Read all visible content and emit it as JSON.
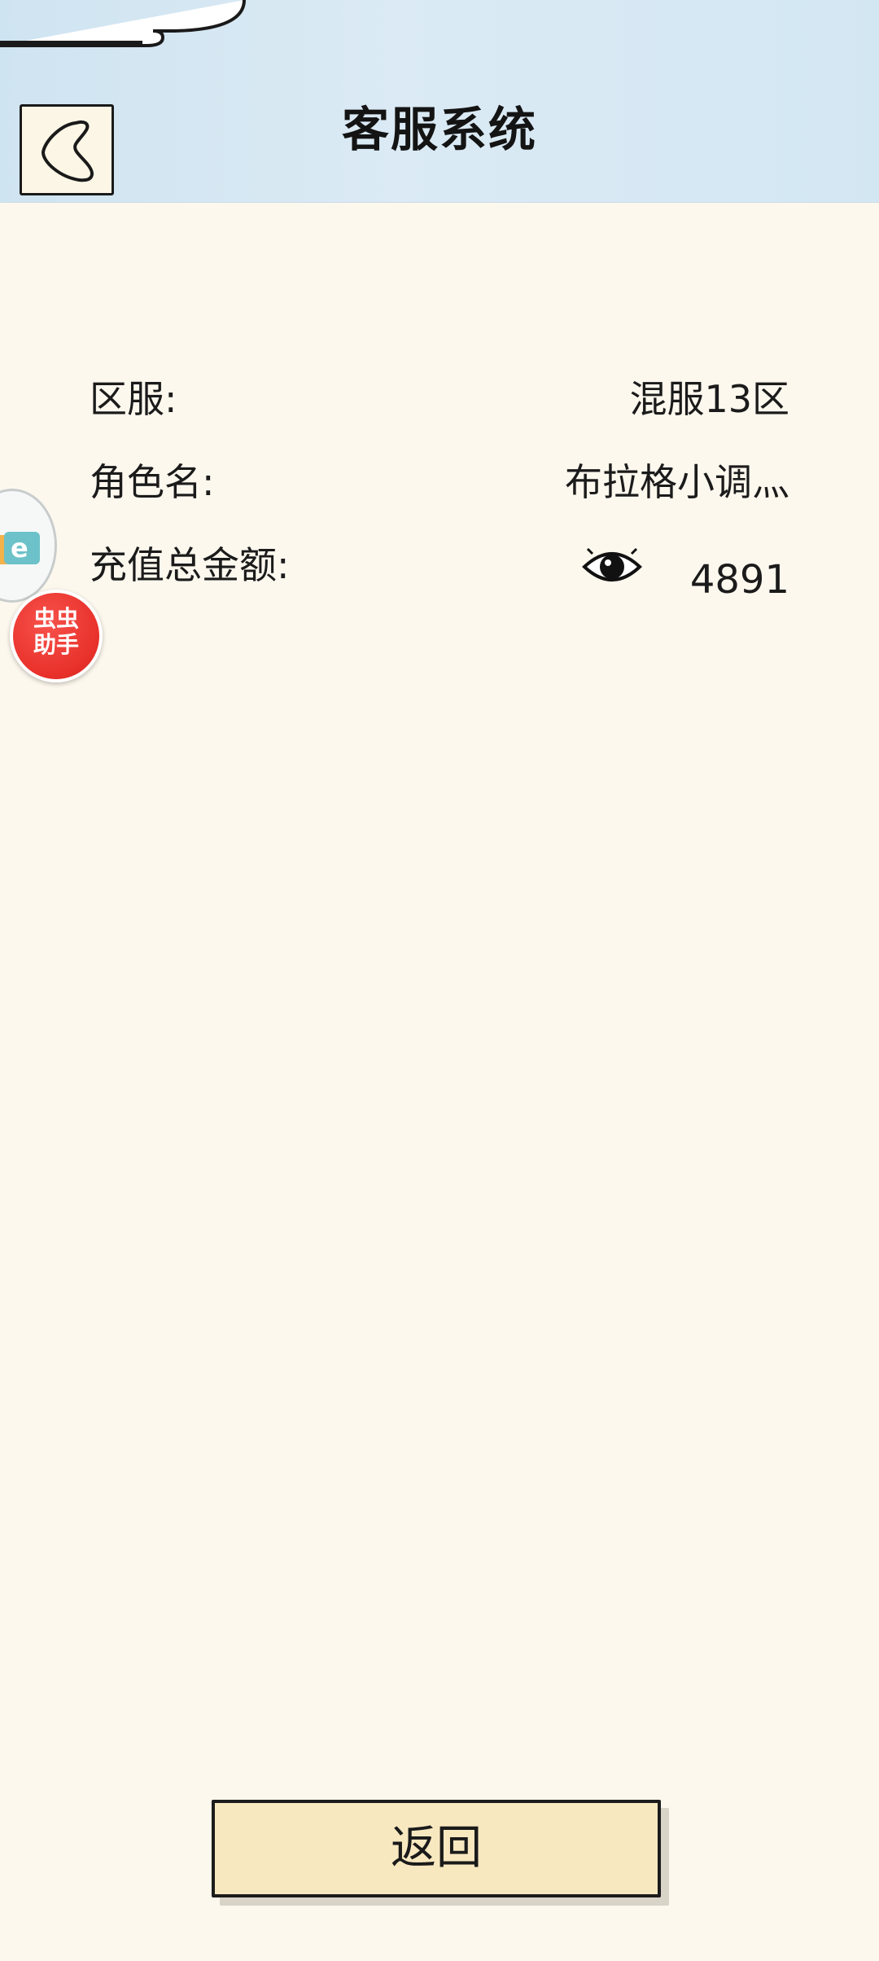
{
  "header": {
    "title": "客服系统",
    "back_icon": "chevron-left-icon"
  },
  "info": {
    "server_label": "区服:",
    "server_value": "混服13区",
    "role_label": "角色名:",
    "role_value": "布拉格小调灬",
    "recharge_label": "充值总金额:",
    "recharge_value": "4891",
    "visibility_icon": "eye-icon"
  },
  "floating": {
    "logo_icon": "app-logo-icon",
    "helper_label_line1": "虫虫",
    "helper_label_line2": "助手"
  },
  "footer": {
    "return_label": "返回"
  },
  "colors": {
    "header_bg": "#d6e8f4",
    "page_bg": "#fdf8ee",
    "button_bg": "#f8e8c0",
    "helper_red": "#e8302a"
  }
}
